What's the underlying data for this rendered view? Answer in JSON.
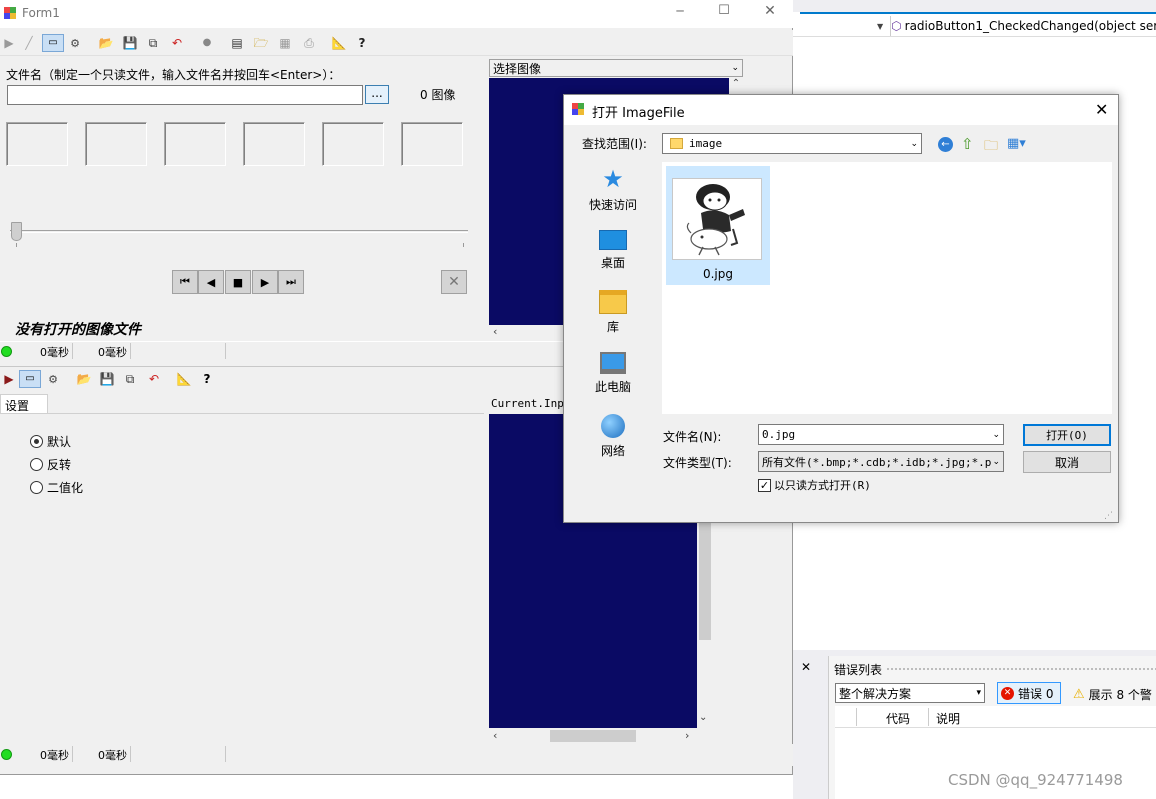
{
  "form": {
    "title": "Form1",
    "icon": "form-icon",
    "controls": {
      "minimize": "─",
      "maximize": "☐",
      "close": "✕"
    }
  },
  "top_panel": {
    "filename_label": "文件名（制定一个只读文件，输入文件名并按回车<Enter>）：",
    "filename_value": "",
    "browse_label": "...",
    "image_count": "0 图像",
    "no_image_text": "没有打开的图像文件",
    "status": {
      "time1": "0毫秒",
      "time2": "0毫秒"
    }
  },
  "select_image": {
    "label": "选择图像"
  },
  "bottom_panel": {
    "tab_label": "设置",
    "radios": [
      {
        "label": "默认",
        "checked": true
      },
      {
        "label": "反转",
        "checked": false
      },
      {
        "label": "二值化",
        "checked": false
      }
    ],
    "current_input_label": "Current.Inpu",
    "status": {
      "time1": "0毫秒",
      "time2": "0毫秒"
    }
  },
  "ide": {
    "method_combo": "radioButton1_CheckedChanged(object ser",
    "error_list": {
      "title": "错误列表",
      "scope": "整个解决方案",
      "errors": "错误 0",
      "warnings": "展示 8 个警",
      "columns": [
        "代码",
        "说明"
      ]
    },
    "watermark": "CSDN @qq_924771498"
  },
  "dialog": {
    "title": "打开 ImageFile",
    "lookin_label": "查找范围(I):",
    "lookin_value": "image",
    "places": [
      {
        "label": "快速访问",
        "icon": "star-icon"
      },
      {
        "label": "桌面",
        "icon": "desktop-icon"
      },
      {
        "label": "库",
        "icon": "library-icon"
      },
      {
        "label": "此电脑",
        "icon": "computer-icon"
      },
      {
        "label": "网络",
        "icon": "network-icon"
      }
    ],
    "file": {
      "name": "0.jpg"
    },
    "filename_label": "文件名(N):",
    "filename_value": "0.jpg",
    "filetype_label": "文件类型(T):",
    "filetype_value": "所有文件(*.bmp;*.cdb;*.idb;*.jpg;*.pn",
    "readonly_label": "以只读方式打开(R)",
    "readonly_checked": true,
    "open_button": "打开(O)",
    "cancel_button": "取消"
  },
  "colors": {
    "navy": "#0a0a64",
    "selection": "#cce8ff",
    "green_led": "#22dd22",
    "ide_accent": "#007acc"
  }
}
